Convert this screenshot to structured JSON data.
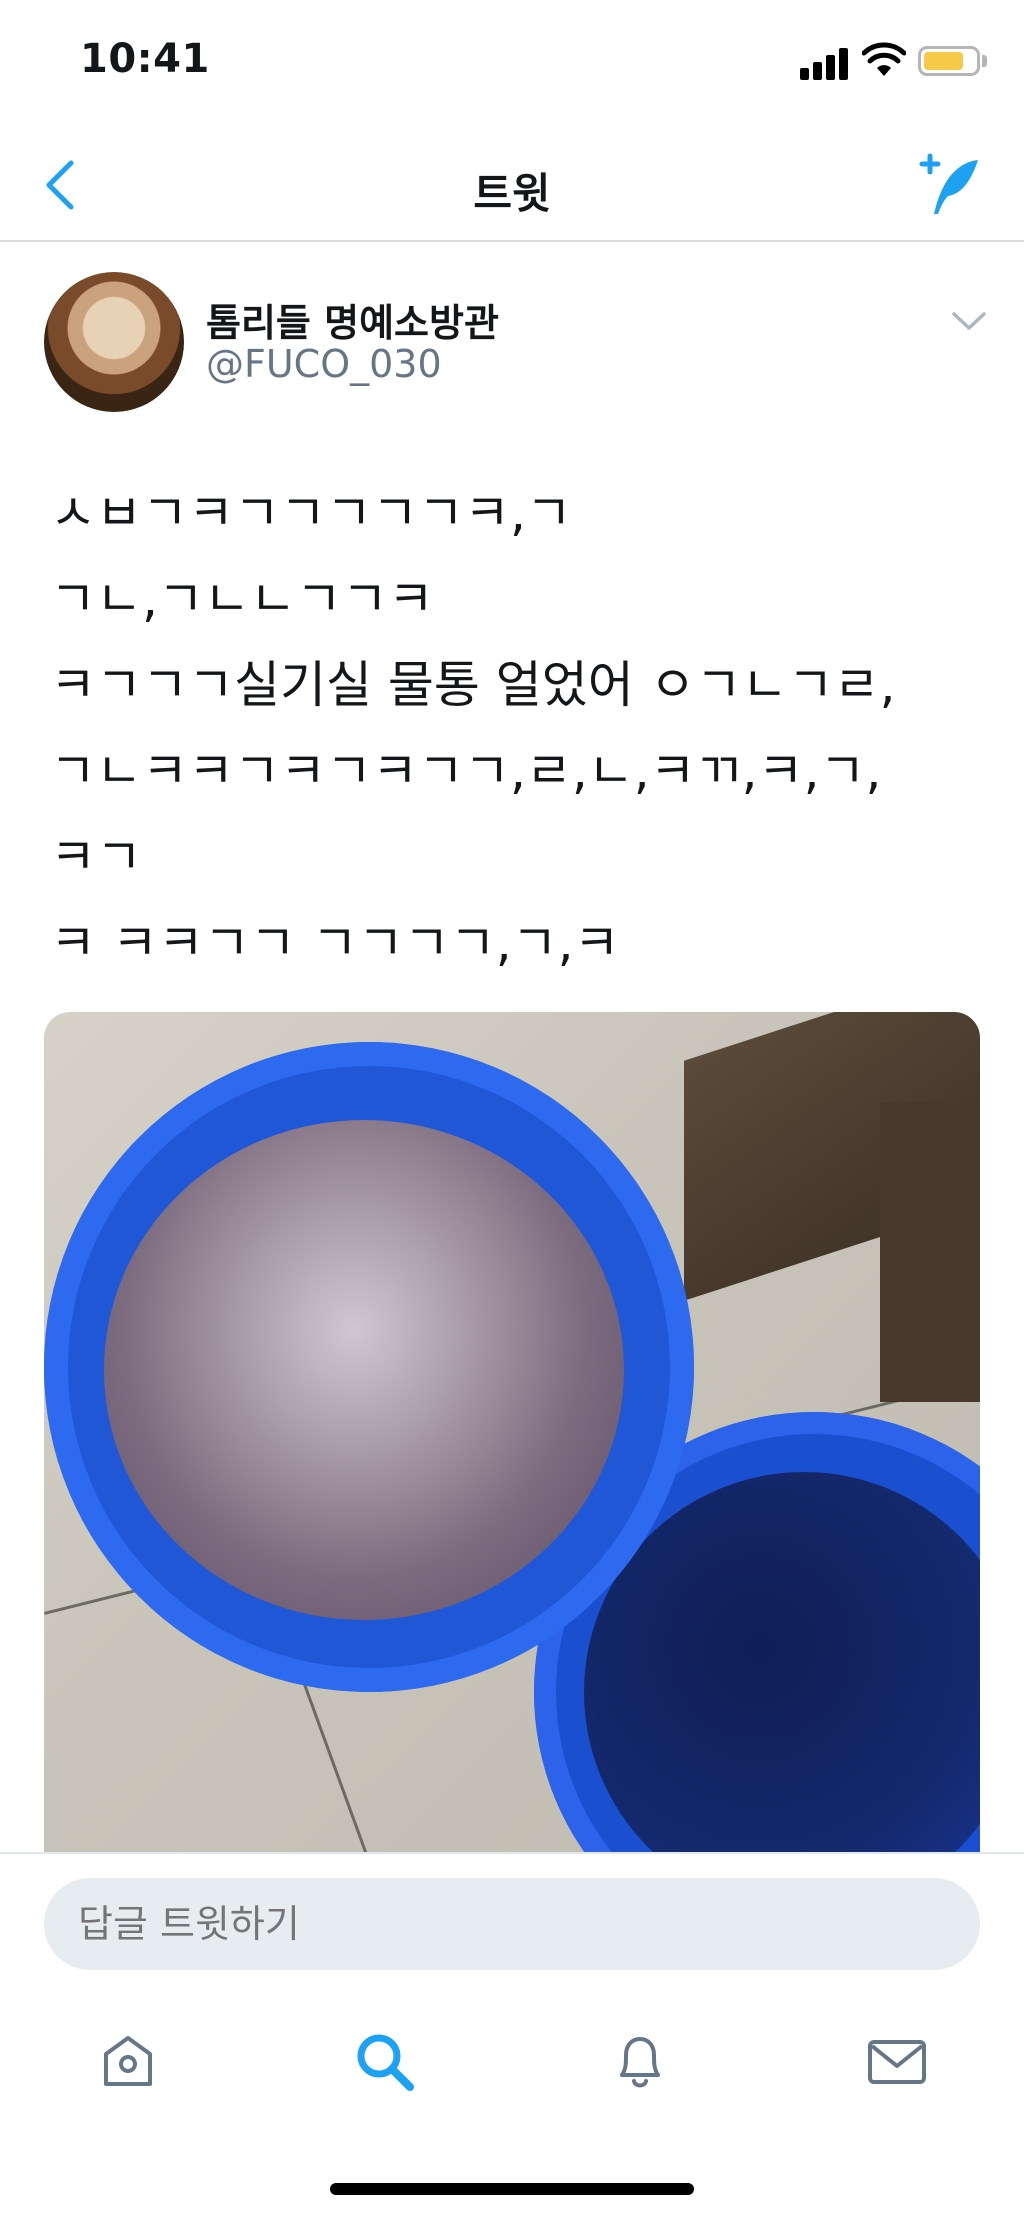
{
  "status_bar": {
    "time": "10:41",
    "battery_level_percent": 78
  },
  "nav": {
    "title": "트윗",
    "back_icon": "chevron-left-icon",
    "compose_icon": "compose-tweet-icon"
  },
  "tweet": {
    "author_name": "톰리들 명예소방관",
    "author_handle": "@FUCO_030",
    "text_lines": [
      "ㅅㅂㄱㅋㄱㄱㄱㄱㄱㅋ,ㄱ",
      "ㄱㄴ,ㄱㄴㄴㄱㄱㅋ",
      "ㅋㄱㄱㄱ실기실 물통 얼었어 ㅇㄱㄴㄱㄹ,",
      "ㄱㄴㅋㅋㄱㅋㄱㅋㄱㄱ,ㄹ,ㄴ,ㅋㄲ,ㅋ,ㄱ,",
      "ㅋㄱ",
      "ㅋ ㅋㅋㄱㄱ ㄱㄱㄱㄱ,ㄱ,ㅋ"
    ]
  },
  "reply": {
    "placeholder": "답글 트윗하기"
  },
  "tab_bar": {
    "items": [
      {
        "name": "home",
        "icon": "home-icon",
        "active": false
      },
      {
        "name": "search",
        "icon": "search-icon",
        "active": true
      },
      {
        "name": "notifications",
        "icon": "bell-icon",
        "active": false
      },
      {
        "name": "messages",
        "icon": "mail-icon",
        "active": false
      }
    ]
  },
  "colors": {
    "accent": "#1da1f2",
    "icon_gray": "#657786",
    "divider": "#e1e8ed",
    "input_bg": "#e6ecf0"
  }
}
